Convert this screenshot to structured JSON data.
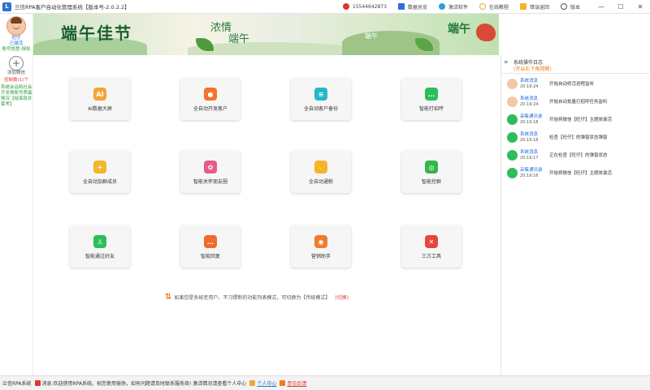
{
  "titlebar": {
    "title": "兰信RPA客户自动化管理系统【版本号-2.0.2.2】",
    "phone": "15544642873",
    "items": [
      "数据总览",
      "激活软件",
      "在线教程",
      "错误返回",
      "版本"
    ],
    "controls": [
      "—",
      "☐",
      "✕"
    ]
  },
  "sidebar": {
    "account_name": "旺仔",
    "account_status": "已激活",
    "account_note": "账号挑登-授权",
    "add_label": "添加微信",
    "control_count": "控制数(1)个",
    "system_notice": "系统会话和社会开发换账号质最情况【结束段并套考】"
  },
  "banner": {
    "title": "端午佳节",
    "mid_left": "浓情",
    "mid_right": "端午",
    "right_small": "端午",
    "right_title": "端午"
  },
  "cards": [
    {
      "label": "AI数据大屏",
      "icon": "ai-icon",
      "color": "#f3a43b",
      "glyph": "AI"
    },
    {
      "label": "全自动开发客户",
      "icon": "user-icon",
      "color": "#f5732a",
      "glyph": "●"
    },
    {
      "label": "全自动客户备份",
      "icon": "database-icon",
      "color": "#25b8c9",
      "glyph": "≡"
    },
    {
      "label": "智能打招呼",
      "icon": "chat-icon",
      "color": "#2dbd5a",
      "glyph": "…"
    },
    {
      "label": "全自动加群成员",
      "icon": "add-member-icon",
      "color": "#f3b52b",
      "glyph": "+"
    },
    {
      "label": "智能关怀朋友圈",
      "icon": "moments-icon",
      "color": "#e45c8a",
      "glyph": "✿"
    },
    {
      "label": "全自动通粉",
      "icon": "hand-icon",
      "color": "#f7b32b",
      "glyph": "✋"
    },
    {
      "label": "智能控群",
      "icon": "group-control-icon",
      "color": "#34b64a",
      "glyph": "◎"
    },
    {
      "label": "智能通过好友",
      "icon": "friend-pass-icon",
      "color": "#2dbd5a",
      "glyph": "♙"
    },
    {
      "label": "智能回复",
      "icon": "reply-icon",
      "color": "#f06a2a",
      "glyph": "…"
    },
    {
      "label": "营销助手",
      "icon": "lifebuoy-icon",
      "color": "#f27a2d",
      "glyph": "◉"
    },
    {
      "label": "三方工具",
      "icon": "tools-icon",
      "color": "#e5483a",
      "glyph": "✕"
    }
  ],
  "notice": {
    "text": "如果您是系统老用户，不习惯新的功能列表模式，可切换为【传统模式】",
    "link": "(切换)"
  },
  "log": {
    "title": "系统操作日志",
    "subtitle": "(开启右下角提醒)",
    "entries": [
      {
        "source": "系统消息",
        "time": "20:19:24",
        "message": "开始自动修活进程监听",
        "icon": "avatar-icon",
        "color": "#f3c7a8"
      },
      {
        "source": "系统消息",
        "time": "20:19:24",
        "message": "开始自动批量打招呼任务监听",
        "icon": "avatar-icon",
        "color": "#f3c7a8"
      },
      {
        "source": "采集通讯录",
        "time": "20:19:18",
        "message": "开始将微信【旺仔】主题体激活",
        "icon": "wechat-icon",
        "color": "#2dbd5a"
      },
      {
        "source": "系统消息",
        "time": "20:19:18",
        "message": "检查【旺仔】的弹窗状态弹窗",
        "icon": "wechat-icon",
        "color": "#2dbd5a"
      },
      {
        "source": "系统消息",
        "time": "20:19:17",
        "message": "正在检查【旺仔】的弹窗状态",
        "icon": "wechat-icon",
        "color": "#2dbd5a"
      },
      {
        "source": "采集通讯录",
        "time": "20:19:16",
        "message": "开始将微信【旺仔】主题体激活",
        "icon": "wechat-icon",
        "color": "#2dbd5a"
      }
    ]
  },
  "statusbar": {
    "app": "兰信RPA系统",
    "message": "消息:欢迎使用RPA系统。祝您使用愉快，如有问题请及时联系服务商! 激活情况请查看个人中心",
    "link1": "个人中心",
    "link2": "意见反馈"
  }
}
